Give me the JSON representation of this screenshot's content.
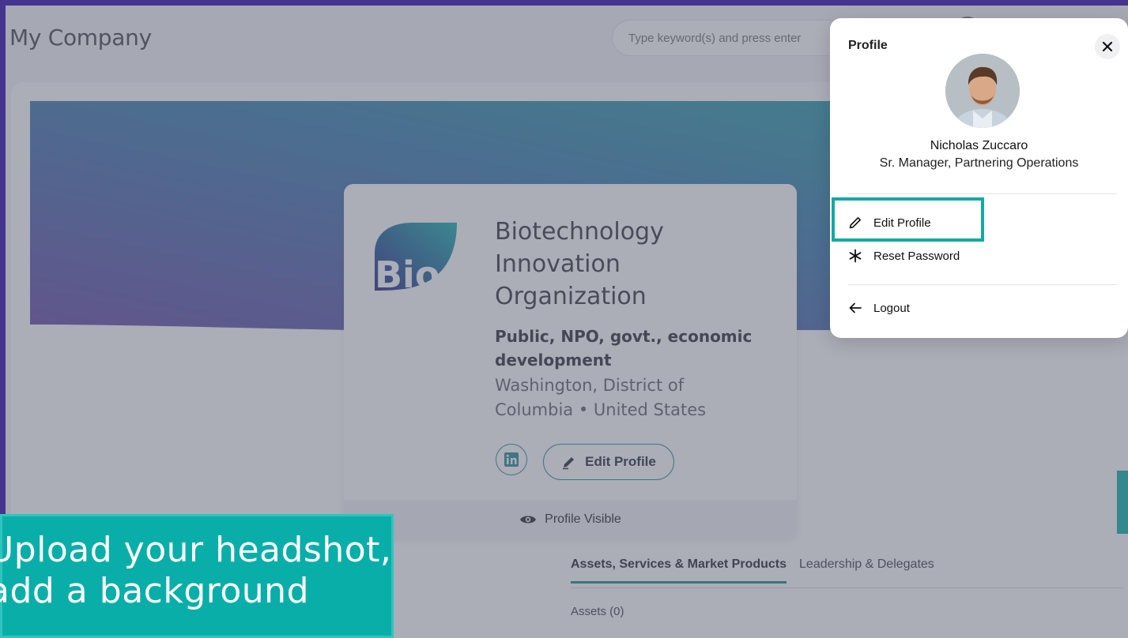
{
  "header": {
    "title": "My Company",
    "search_placeholder": "Type keyword(s) and press enter"
  },
  "organization": {
    "logo_text": "Bio",
    "name": "Biotechnology Innovation Organization",
    "type": "Public, NPO, govt., economic development",
    "location": "Washington, District of Columbia • United States",
    "edit_profile_label": "Edit Profile",
    "visibility_label": "Profile Visible"
  },
  "tabs": [
    {
      "label": "Assets, Services & Market Products"
    },
    {
      "label": "Leadership & Delegates"
    }
  ],
  "assets_label": "Assets (0)",
  "profile_panel": {
    "title": "Profile",
    "user_name": "Nicholas Zuccaro",
    "user_role": "Sr. Manager, Partnering Operations",
    "menu": [
      {
        "label": "Edit Profile",
        "icon": "pencil-icon"
      },
      {
        "label": "Reset Password",
        "icon": "asterisk-icon"
      },
      {
        "label": "Logout",
        "icon": "arrow-left-icon"
      }
    ]
  },
  "callout": {
    "text": "Upload your headshot, add a background"
  },
  "colors": {
    "frame": "#45348f",
    "accent_teal": "#0aaea9",
    "overlay": "rgba(88,92,112,0.5)"
  }
}
